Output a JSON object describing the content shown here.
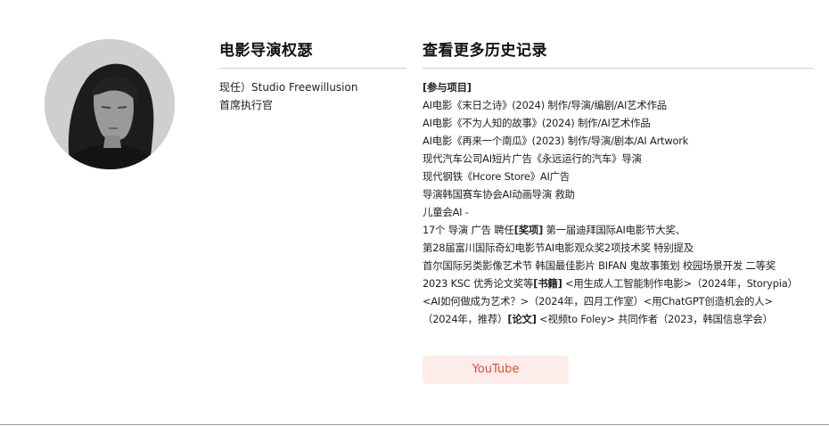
{
  "profile": {
    "name": "电影导演权瑟",
    "role_line1": "现任）Studio Freewillusion",
    "role_line2": "首席执行官"
  },
  "history": {
    "title": "查看更多历史记录",
    "section_participation": "[参与项目]",
    "lines": {
      "l1": "AI电影《末日之诗》(2024) 制作/导演/编剧/AI艺术作品",
      "l2": "AI电影《不为人知的故事》(2024) 制作/AI艺术作品",
      "l3": "AI电影《再来一个南瓜》(2023) 制作/导演/剧本/AI Artwork",
      "l4": "现代汽车公司AI短片广告《永远运行的汽车》导演",
      "l5": "现代钢铁《Hcore Store》AI广告",
      "l6": "导演韩国赛车协会AI动画导演 救助",
      "l7": "儿童会AI -",
      "l8a": "17个 导演 广告 聘任",
      "l8b": "[奖项]",
      "l8c": " 第一届迪拜国际AI电影节大奖、",
      "l9": "第28届富川国际奇幻电影节AI电影观众奖2项技术奖 特别提及",
      "l10": "首尔国际另类影像艺术节 韩国最佳影片 BIFAN 鬼故事策划 校园场景开发 二等奖",
      "l11a": "2023 KSC 优秀论文奖等",
      "l11b": "[书籍]",
      "l11c": " <用生成人工智能制作电影>（2024年，Storypia）",
      "l12": "<AI如何做成为艺术？>（2024年，四月工作室）<用ChatGPT创造机会的人>",
      "l13a": "（2024年，推荐）",
      "l13b": "[论文]",
      "l13c": " <视频to Foley> 共同作者（2023，韩国信息学会）"
    }
  },
  "buttons": {
    "youtube_label": "YouTube"
  },
  "colors": {
    "youtube_bg": "#fdecea",
    "youtube_text": "#d0553d",
    "divider": "#cfcfcf"
  }
}
